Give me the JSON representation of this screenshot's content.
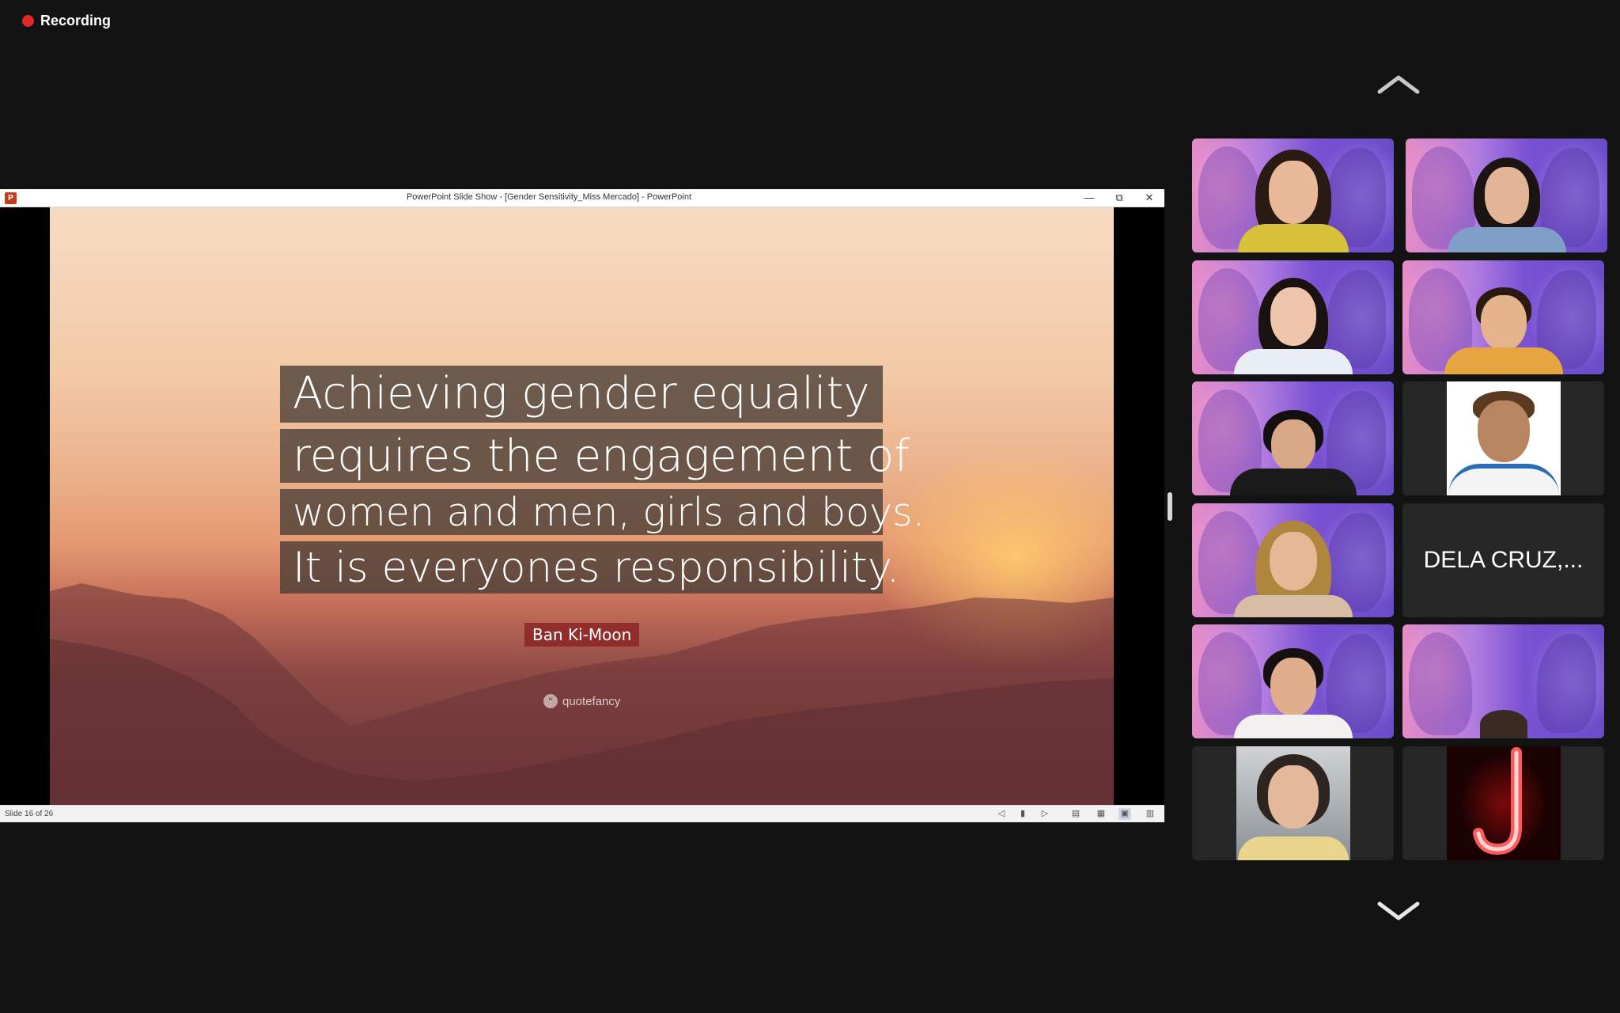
{
  "recording": {
    "label": "Recording",
    "color": "#e02828"
  },
  "ppt": {
    "window_title": "PowerPoint Slide Show - [Gender Sensitivity_Miss Mercado] - PowerPoint",
    "slide": {
      "quote_lines": [
        "Achieving gender equality",
        "requires the engagement of",
        "women and men, girls and boys.",
        "It is everyones responsibility."
      ],
      "author": "Ban Ki-Moon",
      "brand": "quotefancy"
    },
    "status": {
      "slide_indicator": "Slide 16 of 26"
    },
    "status_icons": [
      "previous-icon",
      "pause-icon",
      "next-icon",
      "notes-view-icon",
      "slide-sorter-icon",
      "reading-view-icon",
      "presenter-icon"
    ]
  },
  "gallery": {
    "active_speaker_color": "#3fd35a",
    "name_tile_label": "DELA CRUZ,...",
    "participants": [
      {
        "kind": "virtual-bg",
        "active": true
      },
      {
        "kind": "virtual-bg"
      },
      {
        "kind": "virtual-bg"
      },
      {
        "kind": "virtual-bg"
      },
      {
        "kind": "virtual-bg"
      },
      {
        "kind": "photo"
      },
      {
        "kind": "virtual-bg"
      },
      {
        "kind": "name"
      },
      {
        "kind": "virtual-bg"
      },
      {
        "kind": "virtual-bg"
      },
      {
        "kind": "photo"
      },
      {
        "kind": "photo-neon-j"
      }
    ]
  }
}
